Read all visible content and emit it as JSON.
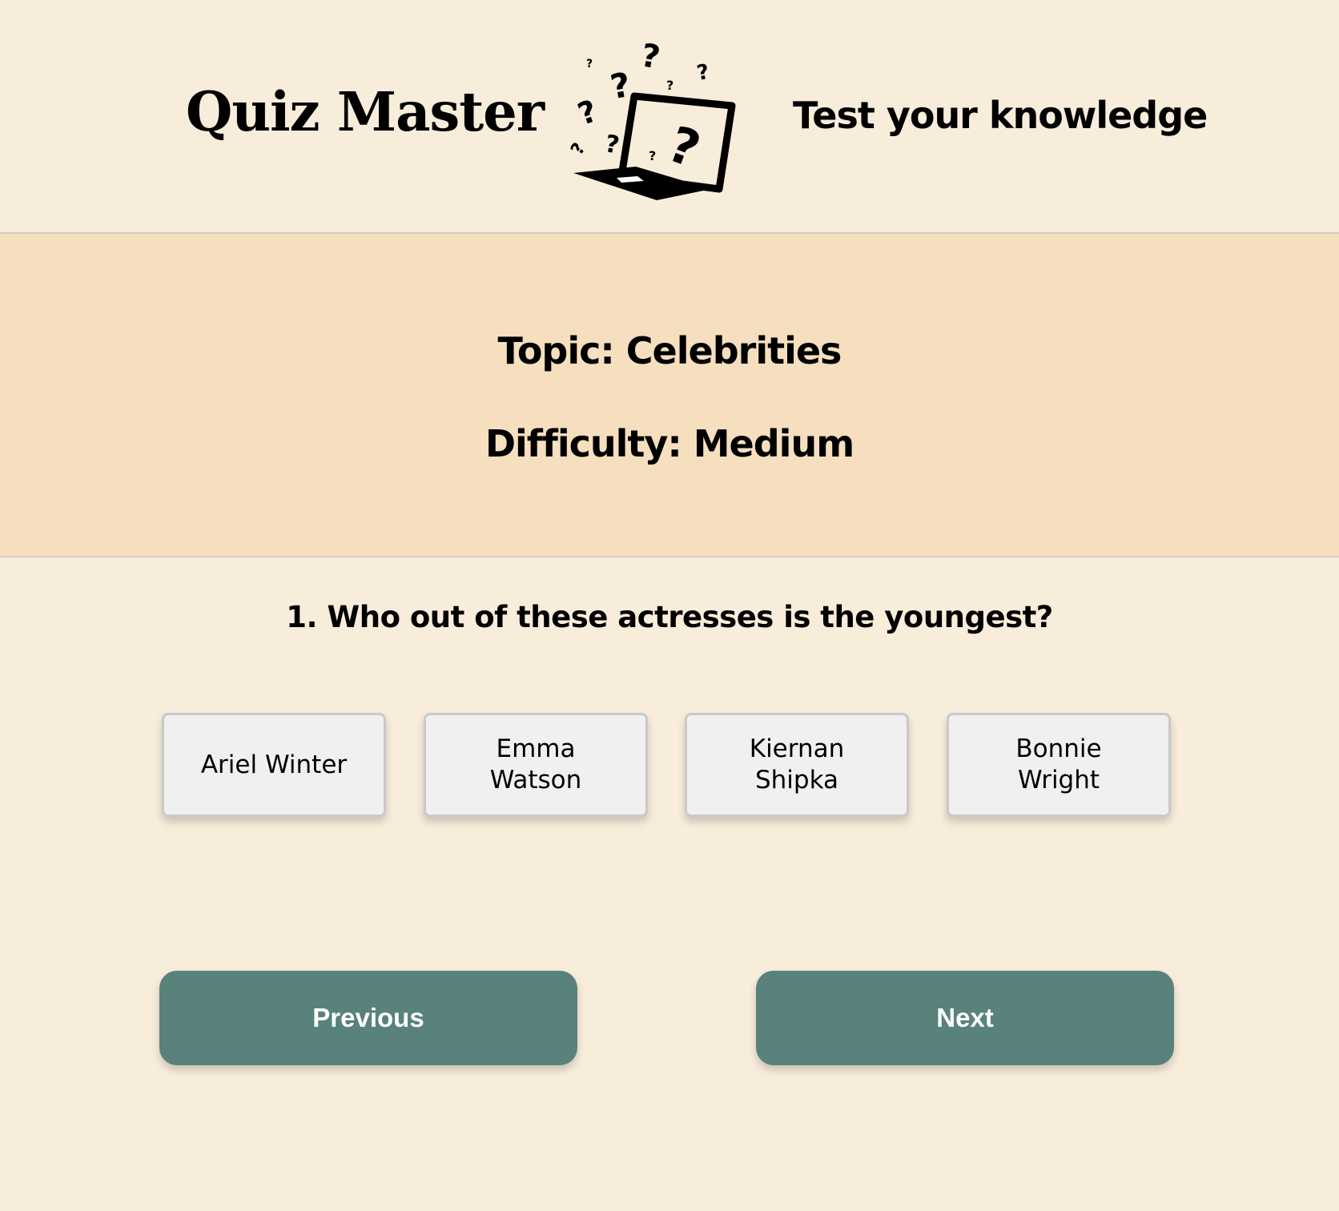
{
  "header": {
    "title": "Quiz Master",
    "tagline": "Test your knowledge",
    "logo_icon": "laptop-question-marks-icon"
  },
  "quiz_info": {
    "topic": "Topic: Celebrities",
    "difficulty": "Difficulty: Medium"
  },
  "question": {
    "text": "1. Who out of these actresses is the youngest?",
    "answers": [
      {
        "label": "Ariel Winter"
      },
      {
        "label": "Emma Watson"
      },
      {
        "label": "Kiernan Shipka"
      },
      {
        "label": "Bonnie Wright"
      }
    ]
  },
  "navigation": {
    "previous_label": "Previous",
    "next_label": "Next"
  },
  "colors": {
    "page_background": "#f8ecdb",
    "info_band": "#f5dfbf",
    "button_accent": "#58827b",
    "answer_card": "#f0f0f0"
  }
}
